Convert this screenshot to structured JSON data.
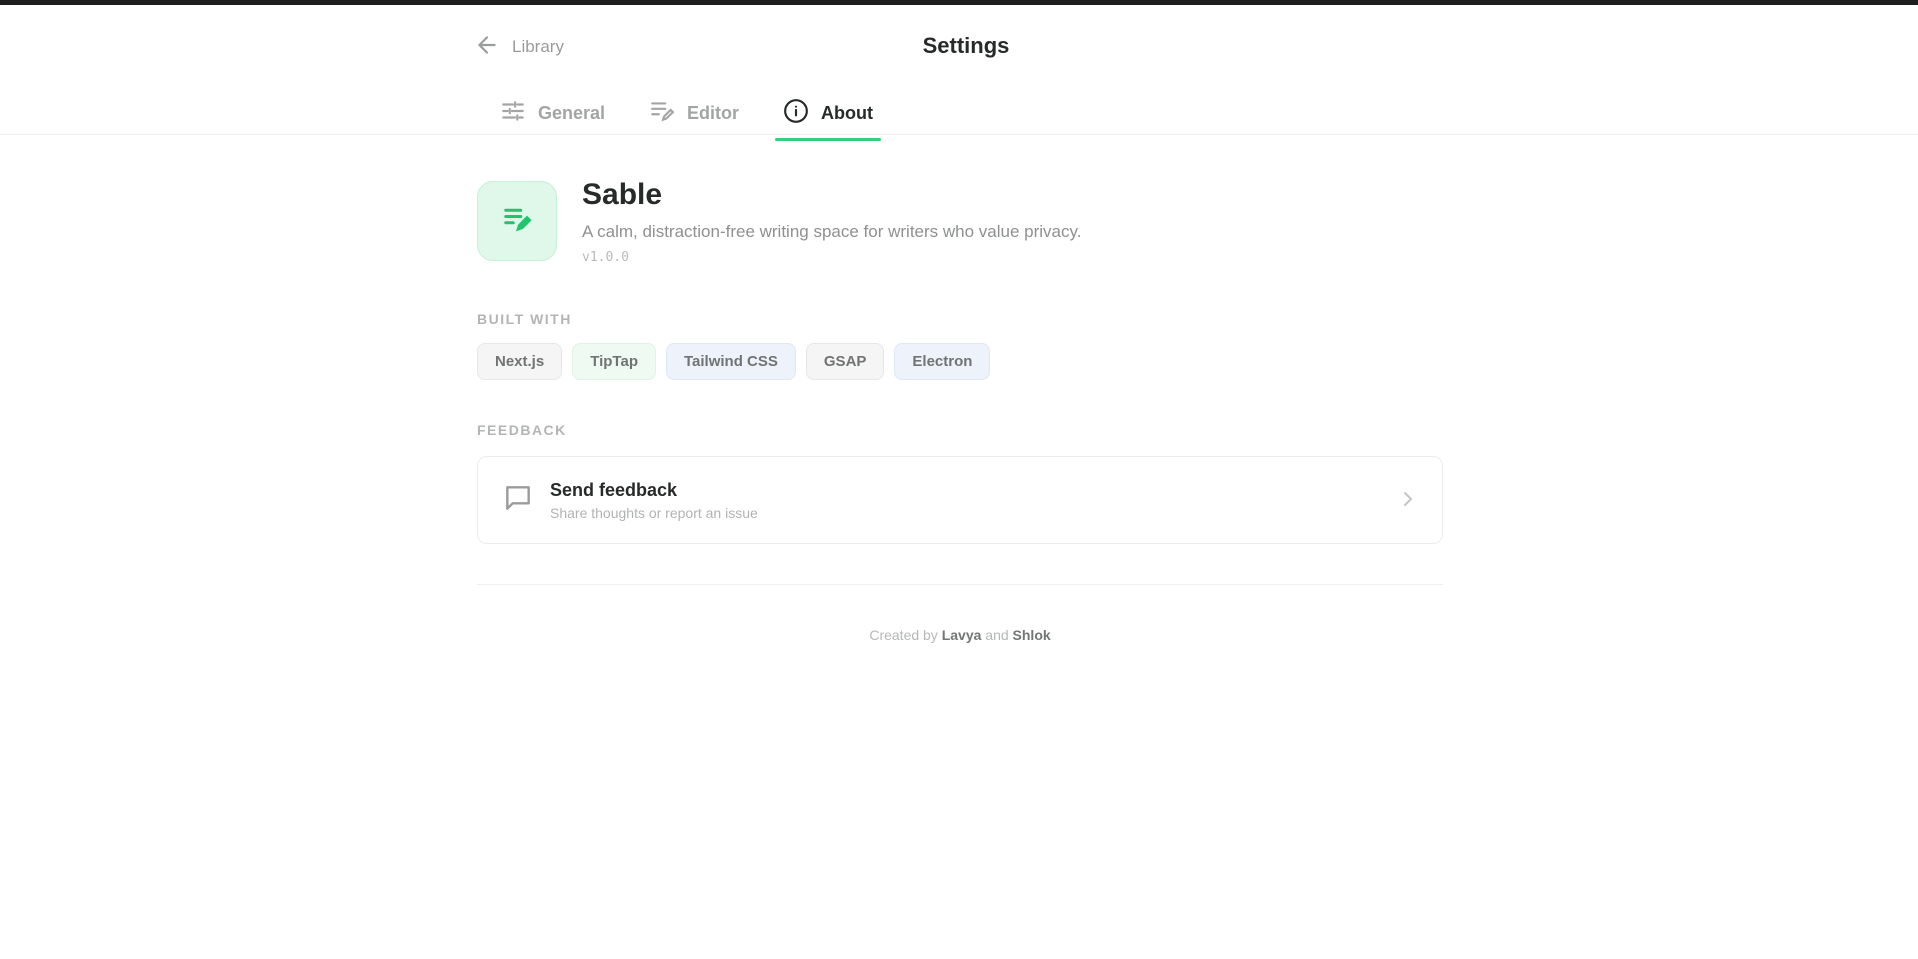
{
  "header": {
    "back_label": "Library",
    "title": "Settings"
  },
  "tabs": [
    {
      "label": "General",
      "icon": "sliders-icon",
      "active": false
    },
    {
      "label": "Editor",
      "icon": "edit-lines-icon",
      "active": false
    },
    {
      "label": "About",
      "icon": "info-icon",
      "active": true
    }
  ],
  "app": {
    "name": "Sable",
    "tagline": "A calm, distraction-free writing space for writers who value privacy.",
    "version": "v1.0.0",
    "icon": "document-pen-icon"
  },
  "built_with": {
    "label": "BUILT WITH",
    "items": [
      "Next.js",
      "TipTap",
      "Tailwind CSS",
      "GSAP",
      "Electron"
    ]
  },
  "feedback": {
    "label": "FEEDBACK",
    "title": "Send feedback",
    "subtitle": "Share thoughts or report an issue",
    "icon": "message-square-icon"
  },
  "credits": {
    "prefix": "Created by",
    "author1": "Lavya",
    "conjunction": "and",
    "author2": "Shlok"
  },
  "colors": {
    "accent": "#2fd27a",
    "accent_bg": "#dff8ea",
    "text": "#262a28",
    "muted": "#a3a5a4"
  }
}
